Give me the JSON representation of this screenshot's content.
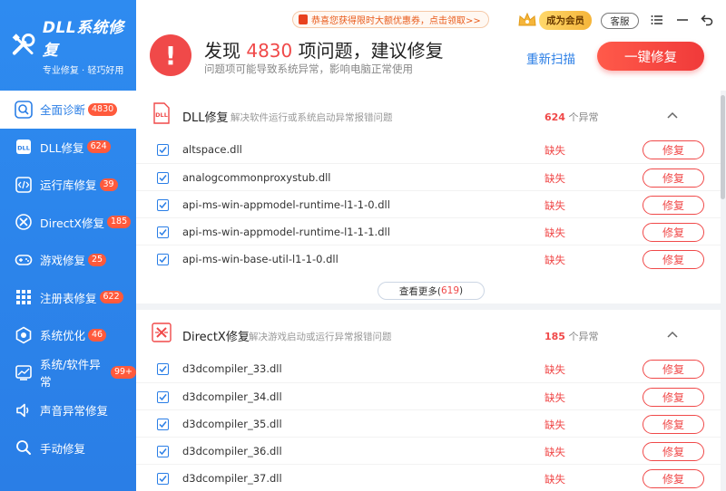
{
  "brand": {
    "title": "DLL系统修复",
    "subtitle": "专业修复 · 轻巧好用"
  },
  "sidebar": {
    "items": [
      {
        "label": "全面诊断",
        "badge": "4830",
        "icon": "search-icon",
        "active": true
      },
      {
        "label": "DLL修复",
        "badge": "624",
        "icon": "dll-icon"
      },
      {
        "label": "运行库修复",
        "badge": "39",
        "icon": "code-icon"
      },
      {
        "label": "DirectX修复",
        "badge": "185",
        "icon": "directx-icon"
      },
      {
        "label": "游戏修复",
        "badge": "25",
        "icon": "gamepad-icon"
      },
      {
        "label": "注册表修复",
        "badge": "622",
        "icon": "registry-icon"
      },
      {
        "label": "系统优化",
        "badge": "46",
        "icon": "optimize-icon"
      },
      {
        "label": "系统/软件异常",
        "badge": "99+",
        "icon": "chart-icon"
      },
      {
        "label": "声音异常修复",
        "badge": "",
        "icon": "speaker-icon"
      },
      {
        "label": "手动修复",
        "badge": "",
        "icon": "search-icon"
      }
    ]
  },
  "topbar": {
    "promo": "恭喜您获得限时大额优惠券，点击领取>>",
    "vip": "成为会员",
    "service": "客服"
  },
  "summary": {
    "prefix": "发现",
    "count": "4830",
    "suffix": "项问题，建议修复",
    "desc": "问题项可能导致系统异常，影响电脑正常使用",
    "rescan": "重新扫描",
    "fix_all": "一键修复"
  },
  "sections": {
    "dll": {
      "title": "DLL修复",
      "desc": "解决软件运行或系统启动异常报错问题",
      "count": "624",
      "unit": "个异常",
      "rows": [
        {
          "name": "altspace.dll",
          "status": "缺失",
          "action": "修复"
        },
        {
          "name": "analogcommonproxystub.dll",
          "status": "缺失",
          "action": "修复"
        },
        {
          "name": "api-ms-win-appmodel-runtime-l1-1-0.dll",
          "status": "缺失",
          "action": "修复"
        },
        {
          "name": "api-ms-win-appmodel-runtime-l1-1-1.dll",
          "status": "缺失",
          "action": "修复"
        },
        {
          "name": "api-ms-win-base-util-l1-1-0.dll",
          "status": "缺失",
          "action": "修复"
        }
      ],
      "more_label": "查看更多(",
      "more_count": "619",
      "more_close": ")"
    },
    "directx": {
      "title": "DirectX修复",
      "desc": "解决游戏启动或运行异常报错问题",
      "count": "185",
      "unit": "个异常",
      "rows": [
        {
          "name": "d3dcompiler_33.dll",
          "status": "缺失",
          "action": "修复"
        },
        {
          "name": "d3dcompiler_34.dll",
          "status": "缺失",
          "action": "修复"
        },
        {
          "name": "d3dcompiler_35.dll",
          "status": "缺失",
          "action": "修复"
        },
        {
          "name": "d3dcompiler_36.dll",
          "status": "缺失",
          "action": "修复"
        },
        {
          "name": "d3dcompiler_37.dll",
          "status": "缺失",
          "action": "修复"
        }
      ]
    }
  },
  "colors": {
    "primary": "#2a7ee6",
    "danger": "#f04949",
    "badge": "#ff5a3c"
  }
}
